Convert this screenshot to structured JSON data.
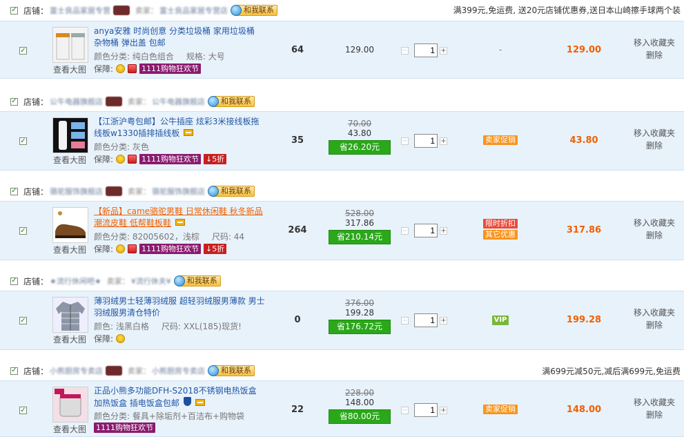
{
  "groups": [
    {
      "shop_label": "店铺：",
      "shop_name": "富士良品家居专营",
      "seller_label": "卖家：",
      "seller_name": "富士良品家居专营店",
      "contact_label": "和我联系",
      "promo": "满399元,免运费, 送20元店铺优惠券,送日本山崎擦手球两个装",
      "item": {
        "title": "anya安雅 时尚创意 分类垃圾桶 家用垃圾桶 杂物桶 弹出盖 包邮",
        "title_style": "normal",
        "attr1": "颜色分类: 纯白色组合",
        "attr2": "规格: 大号",
        "guarantee_label": "保障:",
        "tag_1111": "1111购物狂欢节",
        "discount_tag": "",
        "view_big": "查看大图",
        "quantity_sold": "64",
        "original_price": "",
        "price": "129.00",
        "save": "",
        "qty": "1",
        "promo_text": "-",
        "promo_badge": "",
        "promo_badge2": "",
        "total": "129.00",
        "op_fav": "移入收藏夹",
        "op_del": "删除"
      }
    },
    {
      "shop_label": "店铺：",
      "shop_name": "公牛电器旗舰店",
      "seller_label": "卖家：",
      "seller_name": "公牛电器旗舰店",
      "contact_label": "和我联系",
      "promo": "",
      "item": {
        "title": "【江浙沪粤包邮】公牛插座 炫彩3米接线板拖线板w1330插排插线板",
        "title_style": "normal",
        "attr1": "颜色分类: 灰色",
        "attr2": "",
        "guarantee_label": "保障:",
        "tag_1111": "1111购物狂欢节",
        "discount_tag": "↓5折",
        "view_big": "查看大图",
        "quantity_sold": "35",
        "original_price": "70.00",
        "price": "43.80",
        "save": "省26.20元",
        "qty": "1",
        "promo_text": "",
        "promo_badge": "卖家促销",
        "promo_badge2": "",
        "total": "43.80",
        "op_fav": "移入收藏夹",
        "op_del": "删除"
      }
    },
    {
      "shop_label": "店铺：",
      "shop_name": "骆驼服饰旗舰店",
      "seller_label": "卖家：",
      "seller_name": "骆驼服饰旗舰店",
      "contact_label": "和我联系",
      "promo": "",
      "item": {
        "title": "【新品】came骆驼男鞋 日常休闲鞋 秋冬新品潮流皮鞋 低帮鞋板鞋",
        "title_style": "orange",
        "attr1": "颜色分类: 82005602，浅棕",
        "attr2": "尺码: 44",
        "guarantee_label": "保障:",
        "tag_1111": "1111购物狂欢节",
        "discount_tag": "↓5折",
        "view_big": "查看大图",
        "quantity_sold": "264",
        "original_price": "528.00",
        "price": "317.86",
        "save": "省210.14元",
        "qty": "1",
        "promo_text": "",
        "promo_badge": "限时折扣",
        "promo_badge2": "其它优惠",
        "total": "317.86",
        "op_fav": "移入收藏夹",
        "op_del": "删除"
      }
    },
    {
      "shop_label": "店铺：",
      "shop_name": "★流行休闲吧★",
      "seller_label": "卖家：",
      "seller_name": "¥流行休夫¥",
      "contact_label": "和我联系",
      "promo": "",
      "item": {
        "title": "薄羽绒男士轻薄羽绒服 超轻羽绒服男薄款 男士羽绒服男清仓特价",
        "title_style": "normal",
        "attr1": "颜色: 浅黑白格",
        "attr2": "尺码: XXL(185)现货!",
        "guarantee_label": "保障:",
        "tag_1111": "",
        "discount_tag": "",
        "view_big": "查看大图",
        "quantity_sold": "0",
        "original_price": "376.00",
        "price": "199.28",
        "save": "省176.72元",
        "qty": "1",
        "promo_text": "",
        "promo_badge": "VIP",
        "promo_badge2": "",
        "total": "199.28",
        "op_fav": "移入收藏夹",
        "op_del": "删除"
      }
    },
    {
      "shop_label": "店铺：",
      "shop_name": "小熊厨房专卖店",
      "seller_label": "卖家：",
      "seller_name": "小熊厨房专卖店",
      "contact_label": "和我联系",
      "promo": "满699元减50元,减后满699元,免运费",
      "item": {
        "title": "正品小熊多功能DFH-S2018不锈钢电热饭盒 加热饭盒 插电饭盒包邮",
        "title_style": "normal",
        "attr1": "颜色分类: 餐具+除垢剂+百洁布+购物袋",
        "attr2": "",
        "guarantee_label": "",
        "tag_1111": "1111购物狂欢节",
        "discount_tag": "",
        "view_big": "查看大图",
        "quantity_sold": "22",
        "original_price": "228.00",
        "price": "148.00",
        "save": "省80.00元",
        "qty": "1",
        "promo_text": "",
        "promo_badge": "卖家促销",
        "promo_badge2": "",
        "total": "148.00",
        "op_fav": "移入收藏夹",
        "op_del": "删除"
      }
    }
  ]
}
